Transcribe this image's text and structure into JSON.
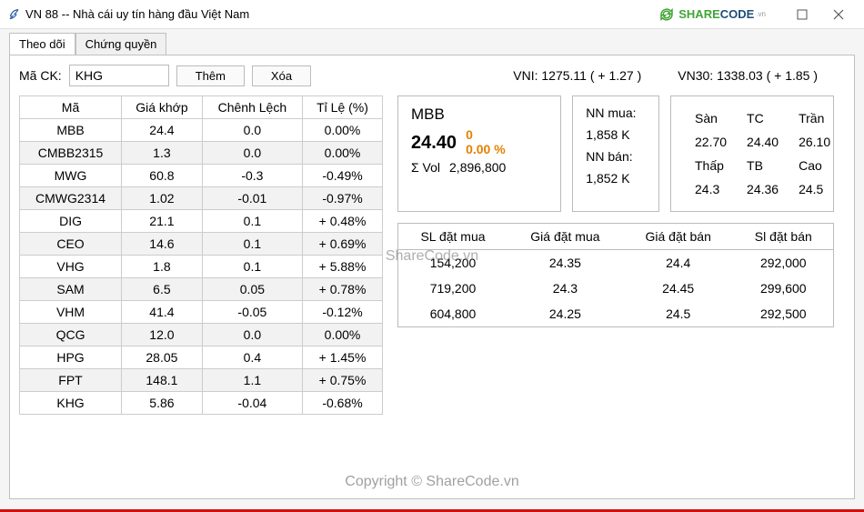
{
  "titlebar": {
    "title": "VN 88 -- Nhà cái uy tín hàng đầu Việt Nam",
    "brand_share": "SHARE",
    "brand_code": "CODE",
    "brand_vn": ".vn"
  },
  "tabs": {
    "tab1": "Theo dõi",
    "tab2": "Chứng quyền"
  },
  "controls": {
    "label_mack": "Mã CK:",
    "input_value": "KHG",
    "btn_add": "Thêm",
    "btn_del": "Xóa"
  },
  "indices": {
    "vni": "VNI: 1275.11 ( + 1.27 )",
    "vn30": "VN30:   1338.03   ( + 1.85 )"
  },
  "watchlist": {
    "headers": {
      "ma": "Mã",
      "gia": "Giá khớp",
      "chenh": "Chênh Lệch",
      "tile": "Tỉ Lệ (%)"
    },
    "rows": [
      {
        "ma": "MBB",
        "gia": "24.4",
        "chenh": "0.0",
        "tile": "0.00%"
      },
      {
        "ma": "CMBB2315",
        "gia": "1.3",
        "chenh": "0.0",
        "tile": "0.00%"
      },
      {
        "ma": "MWG",
        "gia": "60.8",
        "chenh": "-0.3",
        "tile": "-0.49%"
      },
      {
        "ma": "CMWG2314",
        "gia": "1.02",
        "chenh": "-0.01",
        "tile": "-0.97%"
      },
      {
        "ma": "DIG",
        "gia": "21.1",
        "chenh": "0.1",
        "tile": "+ 0.48%"
      },
      {
        "ma": "CEO",
        "gia": "14.6",
        "chenh": "0.1",
        "tile": "+ 0.69%"
      },
      {
        "ma": "VHG",
        "gia": "1.8",
        "chenh": "0.1",
        "tile": "+ 5.88%"
      },
      {
        "ma": "SAM",
        "gia": "6.5",
        "chenh": "0.05",
        "tile": "+ 0.78%"
      },
      {
        "ma": "VHM",
        "gia": "41.4",
        "chenh": "-0.05",
        "tile": "-0.12%"
      },
      {
        "ma": "QCG",
        "gia": "12.0",
        "chenh": "0.0",
        "tile": "0.00%"
      },
      {
        "ma": "HPG",
        "gia": "28.05",
        "chenh": "0.4",
        "tile": "+ 1.45%"
      },
      {
        "ma": "FPT",
        "gia": "148.1",
        "chenh": "1.1",
        "tile": "+ 0.75%"
      },
      {
        "ma": "KHG",
        "gia": "5.86",
        "chenh": "-0.04",
        "tile": "-0.68%"
      }
    ]
  },
  "detail": {
    "sym": "MBB",
    "price": "24.40",
    "change": "0",
    "pct": "0.00 %",
    "vol_label": "Σ Vol",
    "vol": "2,896,800",
    "nn_mua_label": "NN mua:",
    "nn_mua": "1,858 K",
    "nn_ban_label": "NN bán:",
    "nn_ban": "1,852 K",
    "headers": {
      "san": "Sàn",
      "tc": "TC",
      "tran": "Trần",
      "thap": "Thấp",
      "tb": "TB",
      "cao": "Cao"
    },
    "san": "22.70",
    "tc": "24.40",
    "tran": "26.10",
    "thap": "24.3",
    "tb": "24.36",
    "cao": "24.5"
  },
  "orders": {
    "headers": {
      "slm": "SL đặt mua",
      "gm": "Giá đặt mua",
      "gb": "Giá đặt bán",
      "slb": "Sl đặt bán"
    },
    "rows": [
      {
        "slm": "154,200",
        "gm": "24.35",
        "gb": "24.4",
        "slb": "292,000"
      },
      {
        "slm": "719,200",
        "gm": "24.3",
        "gb": "24.45",
        "slb": "299,600"
      },
      {
        "slm": "604,800",
        "gm": "24.25",
        "gb": "24.5",
        "slb": "292,500"
      }
    ]
  },
  "watermark": {
    "center": "ShareCode.vn",
    "bottom": "Copyright © ShareCode.vn"
  }
}
